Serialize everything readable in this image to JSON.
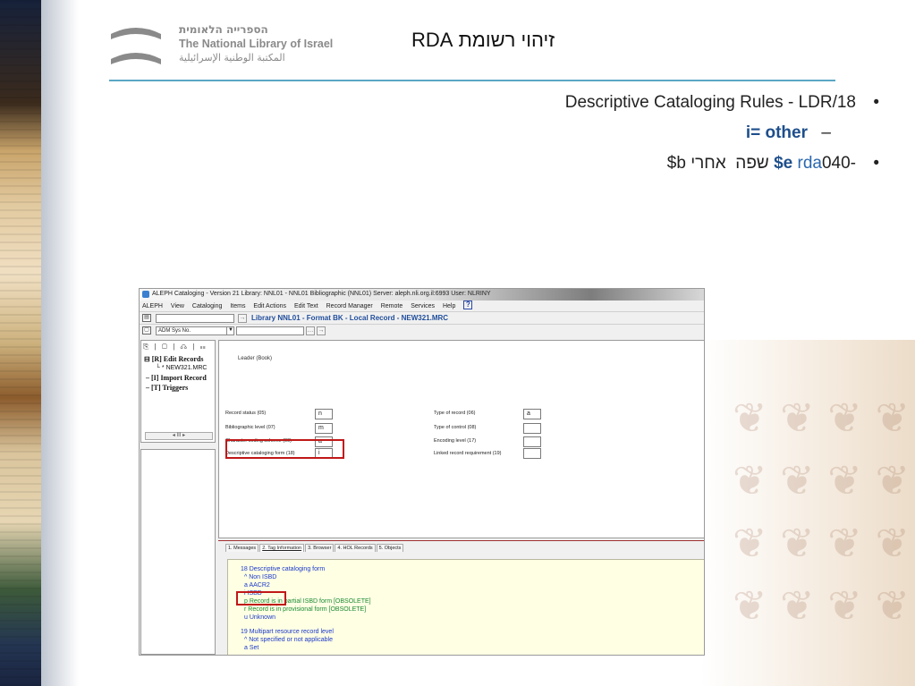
{
  "slide": {
    "logo": {
      "hebrew": "הספרייה הלאומית",
      "english": "The National Library of Israel",
      "arabic": "المكتبة الوطنية الإسرائيلية"
    },
    "title": "זיהוי רשומת RDA",
    "bullets": {
      "b1": "Descriptive Cataloging Rules - LDR/18",
      "b1_sub_dash": "–",
      "b1_sub": "i= other",
      "b2_code": "040-",
      "b2_rda": "rda",
      "b2_se": "$e",
      "b2_after": "אחרי",
      "b2_rest": "$b שפה",
      "dot": "•"
    },
    "accent_color": "#5aa7c4"
  },
  "aleph": {
    "titlebar": "ALEPH Cataloging - Version 21  Library:  NNL01 - NNL01 Bibliographic (NNL01)  Server:  aleph.nli.org.il:6993  User:  NLRINY",
    "menu": {
      "aleph": "ALEPH",
      "view": "View",
      "cataloging": "Cataloging",
      "items": "Items",
      "edit_actions": "Edit Actions",
      "edit_text": "Edit Text",
      "record_manager": "Record Manager",
      "remote": "Remote",
      "services": "Services",
      "help": "Help",
      "help_icon": "?"
    },
    "toolbar": {
      "library_title": "Library NNL01 - Format BK - Local Record - NEW321.MRC",
      "adm_field": "ADM Sys No.",
      "search_value": ""
    },
    "tree": {
      "tabs": "⎘ | ▢ | ☊ | ☷",
      "edit_records": "[R] Edit Records",
      "new_record": "NEW321.MRC",
      "import_record": "[I] Import Record",
      "triggers": "[T] Triggers",
      "scroll_label": "III"
    },
    "form": {
      "leader_title": "Leader (Book)",
      "record_status_label": "Record status (05)",
      "record_status_value": "n",
      "bib_level_label": "Bibliographic level (07)",
      "bib_level_value": "m",
      "char_coding_label": "Character coding scheme (09)",
      "char_coding_value": "a",
      "desc_cat_label": "Descriptive cataloging form (18)",
      "desc_cat_value": "i",
      "type_record_label": "Type of record (06)",
      "type_record_value": "a",
      "type_control_label": "Type of control (08)",
      "type_control_value": "",
      "encoding_label": "Encoding level (17)",
      "encoding_value": "",
      "linked_label": "Linked record requirement (19)",
      "linked_value": ""
    },
    "bottom_tabs": {
      "t1": "1. Messages",
      "t2": "2. Tag Information",
      "t3": "3. Browser",
      "t4": "4. HOL Records",
      "t5": "5. Objects"
    },
    "tag_info": {
      "l1": "18 Descriptive cataloging form",
      "l2": "^ Non ISBD",
      "l3": "a AACR2",
      "l4": "i ISBD",
      "l5": "p Record is in partial ISBD form [OBSOLETE]",
      "l6": "r Record is in provisional form [OBSOLETE]",
      "l7": "u Unknown",
      "l8": "19 Multipart resource record level",
      "l9": "^ Not specified or not applicable",
      "l10": "a Set"
    }
  }
}
